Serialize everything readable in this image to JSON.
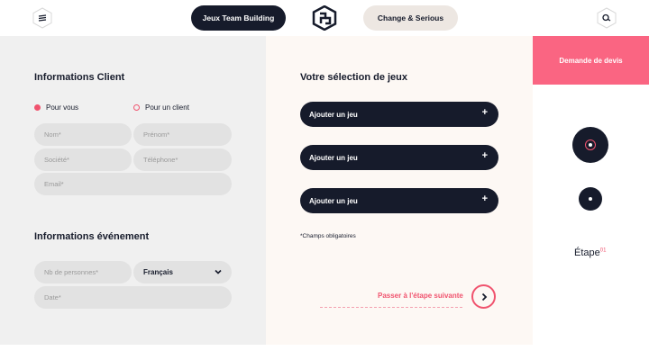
{
  "header": {
    "menu_icon": "menu-icon",
    "search_icon": "search-icon",
    "logo_icon": "brand-logo",
    "nav_primary": "Jeux Team Building",
    "nav_secondary": "Change & Serious"
  },
  "client": {
    "title": "Informations Client",
    "radio_for_you": "Pour vous",
    "radio_for_client": "Pour un client",
    "fields": {
      "nom": "Nom*",
      "prenom": "Prénom*",
      "societe": "Société*",
      "telephone": "Téléphone*",
      "email": "Email*"
    }
  },
  "event": {
    "title": "Informations événement",
    "nb_personnes": "Nb de personnes*",
    "langue": "Français",
    "date": "Date*"
  },
  "games": {
    "title": "Votre sélection de jeux",
    "add_label": "Ajouter un jeu",
    "plus": "+",
    "required_note": "*Champs obligatoires",
    "next_label": "Passer à l'étape suivante"
  },
  "side": {
    "quote_label": "Demande de devis",
    "step_label": "Étape",
    "step_number": "01"
  },
  "colors": {
    "dark": "#161b2b",
    "accent": "#f0536e",
    "quote_bg": "#fa6582"
  }
}
